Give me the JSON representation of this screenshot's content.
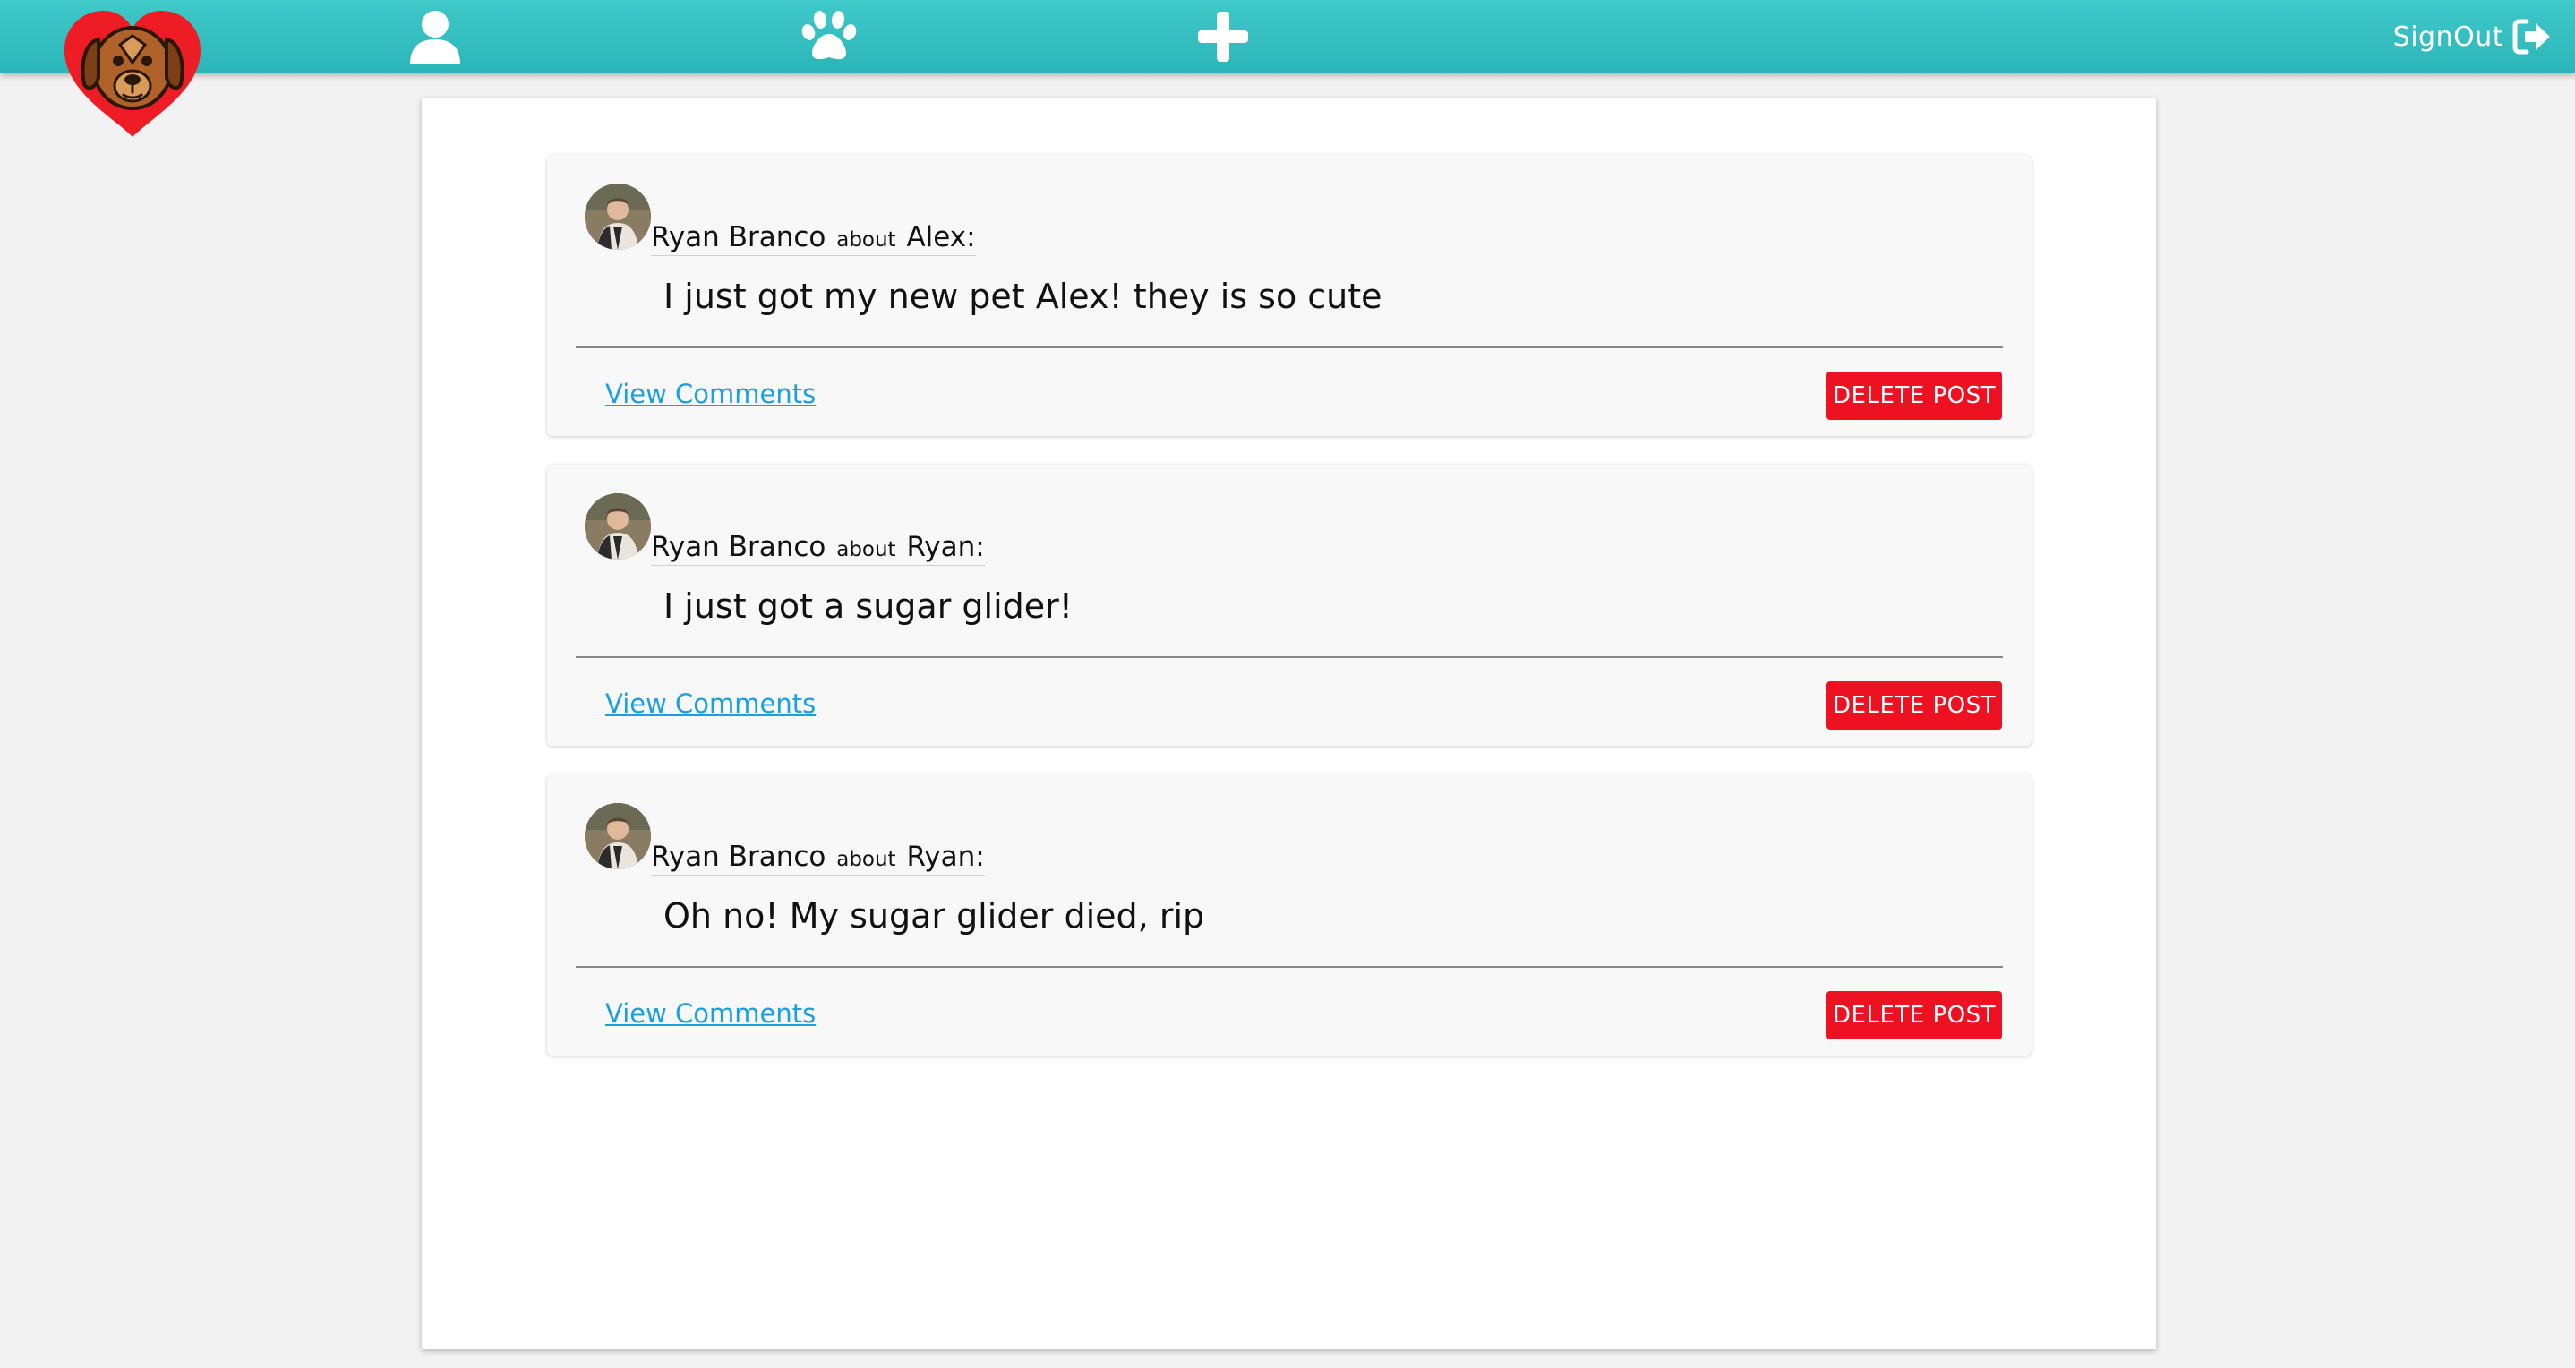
{
  "nav": {
    "logo_icon": "dog-heart-logo",
    "profile_icon": "user-icon",
    "pets_icon": "paw-icon",
    "add_icon": "plus-icon",
    "signout_label": "SignOut",
    "signout_icon": "sign-out-icon"
  },
  "colors": {
    "nav_accent": "#3fc9c9",
    "delete_button": "#ee1122",
    "link": "#1a9fe0"
  },
  "posts": [
    {
      "author": "Ryan Branco",
      "about_word": "about",
      "subject": "Alex:",
      "text": "I just got my new pet Alex! they is so cute",
      "view_comments_label": "View Comments",
      "delete_label": "DELETE POST"
    },
    {
      "author": "Ryan Branco",
      "about_word": "about",
      "subject": "Ryan:",
      "text": "I just got a sugar glider!",
      "view_comments_label": "View Comments",
      "delete_label": "DELETE POST"
    },
    {
      "author": "Ryan Branco",
      "about_word": "about",
      "subject": "Ryan:",
      "text": "Oh no! My sugar glider died, rip",
      "view_comments_label": "View Comments",
      "delete_label": "DELETE POST"
    }
  ]
}
